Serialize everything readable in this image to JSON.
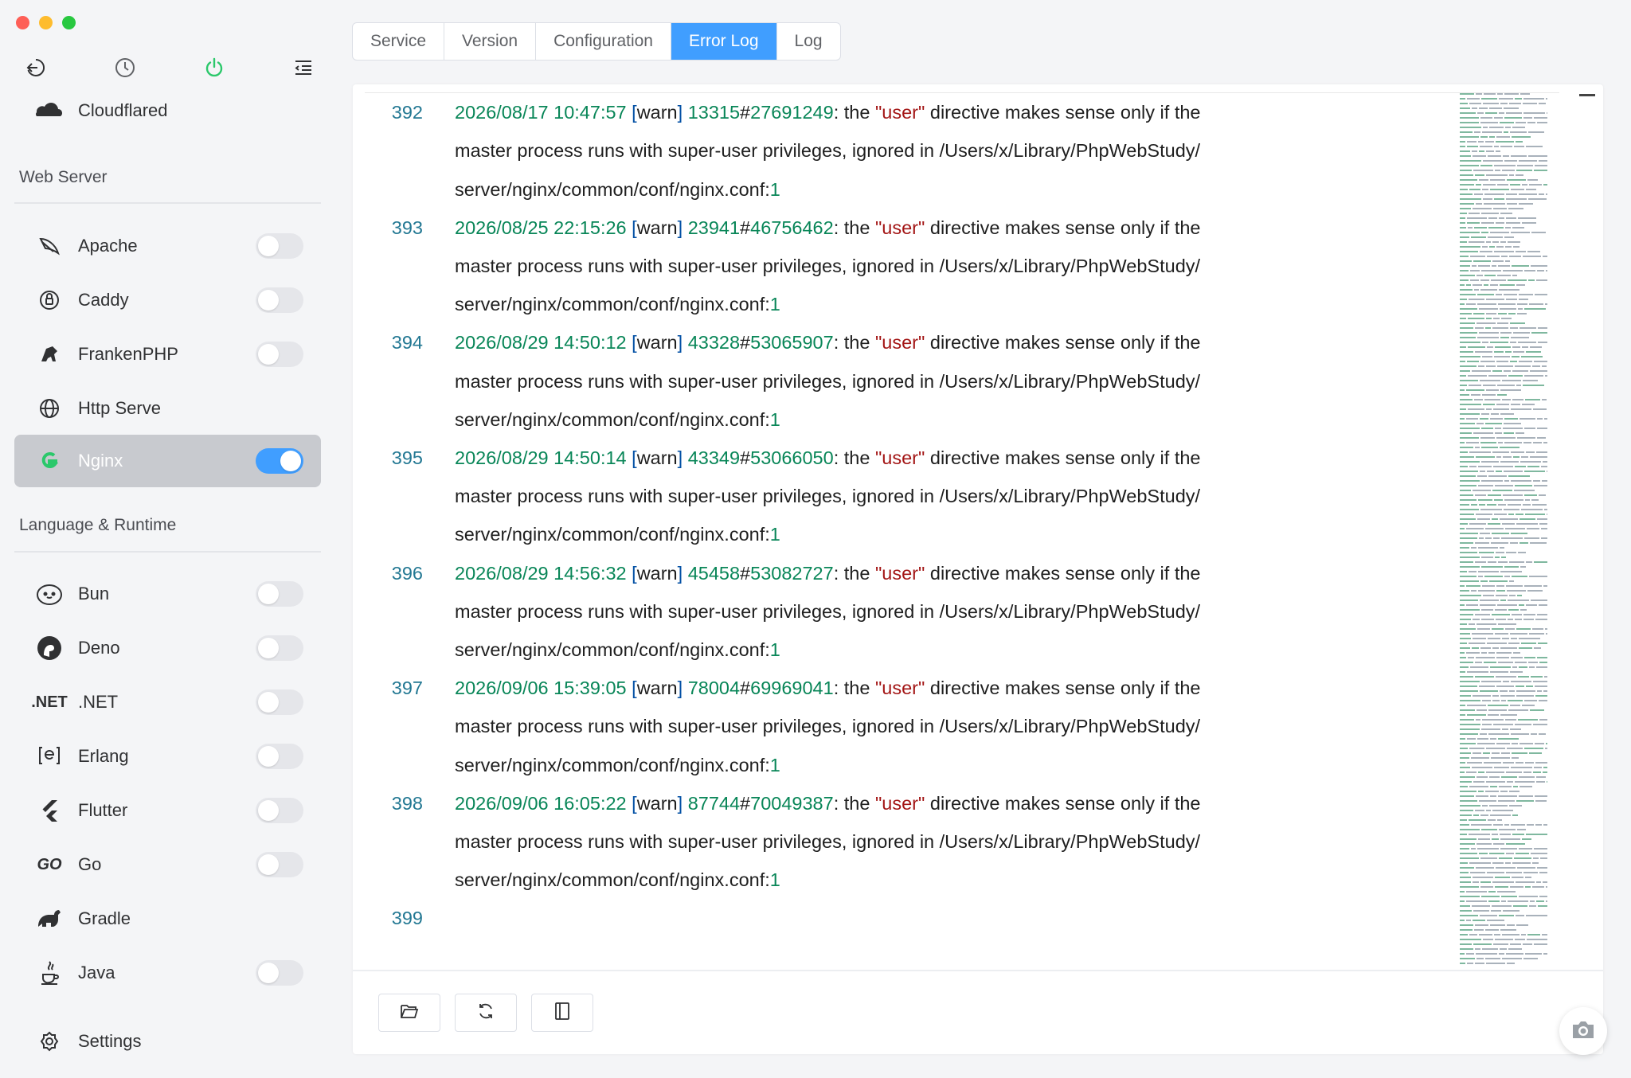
{
  "sidebar": {
    "top_icons": [
      "back-icon",
      "history-icon",
      "power-icon",
      "menu-collapse-icon"
    ],
    "cloudflared_label": "Cloudflared",
    "sections": {
      "web_server": "Web Server",
      "language_runtime": "Language & Runtime"
    },
    "web_server_items": [
      {
        "label": "Apache",
        "icon": "feather-icon",
        "enabled": false
      },
      {
        "label": "Caddy",
        "icon": "caddy-icon",
        "enabled": false
      },
      {
        "label": "FrankenPHP",
        "icon": "frankenphp-icon",
        "enabled": false
      },
      {
        "label": "Http Serve",
        "icon": "globe-icon",
        "enabled": null
      },
      {
        "label": "Nginx",
        "icon": "nginx-icon",
        "enabled": true
      }
    ],
    "runtime_items": [
      {
        "label": "Bun",
        "icon": "bun-icon",
        "enabled": false
      },
      {
        "label": "Deno",
        "icon": "deno-icon",
        "enabled": false
      },
      {
        "label": ".NET",
        "icon_text": ".NET",
        "enabled": false
      },
      {
        "label": "Erlang",
        "icon": "erlang-icon",
        "enabled": false
      },
      {
        "label": "Flutter",
        "icon": "flutter-icon",
        "enabled": false
      },
      {
        "label": "Go",
        "icon_text": "GO",
        "enabled": false
      },
      {
        "label": "Gradle",
        "icon": "gradle-icon",
        "enabled": null
      },
      {
        "label": "Java",
        "icon": "java-icon",
        "enabled": false
      }
    ],
    "settings_label": "Settings"
  },
  "tabs": {
    "service": "Service",
    "version": "Version",
    "configuration": "Configuration",
    "error_log": "Error Log",
    "log": "Log",
    "active": "Error Log"
  },
  "log": {
    "partial_first": "server/nginx/common/conf/nginx.conf:1",
    "entries": [
      {
        "n": "392",
        "date": "2026/08/17 10:47:57",
        "pid": "13315",
        "tid": "27691249"
      },
      {
        "n": "393",
        "date": "2026/08/25 22:15:26",
        "pid": "23941",
        "tid": "46756462"
      },
      {
        "n": "394",
        "date": "2026/08/29 14:50:12",
        "pid": "43328",
        "tid": "53065907"
      },
      {
        "n": "395",
        "date": "2026/08/29 14:50:14",
        "pid": "43349",
        "tid": "53066050"
      },
      {
        "n": "396",
        "date": "2026/08/29 14:56:32",
        "pid": "45458",
        "tid": "53082727"
      },
      {
        "n": "397",
        "date": "2026/09/06 15:39:05",
        "pid": "78004",
        "tid": "69969041"
      },
      {
        "n": "398",
        "date": "2026/09/06 16:05:22",
        "pid": "87744",
        "tid": "70049387"
      }
    ],
    "last_line_number": "399",
    "level": "warn",
    "msg_before": ": the ",
    "quoted": "\"user\"",
    "msg_after": " directive makes sense only if the",
    "line2": "master process runs with super-user privileges, ignored in /Users/x/Library/PhpWebStudy/",
    "line3_path": "server/nginx/common/conf/nginx.conf:",
    "line3_num": "1"
  },
  "footer": {
    "buttons": [
      "folder-open-icon",
      "refresh-icon",
      "sidebar-panel-icon"
    ]
  },
  "colors": {
    "accent": "#409eff",
    "line_number": "#237893",
    "log_date": "#098658",
    "log_bracket": "#0451a5",
    "log_string": "#a31515"
  }
}
